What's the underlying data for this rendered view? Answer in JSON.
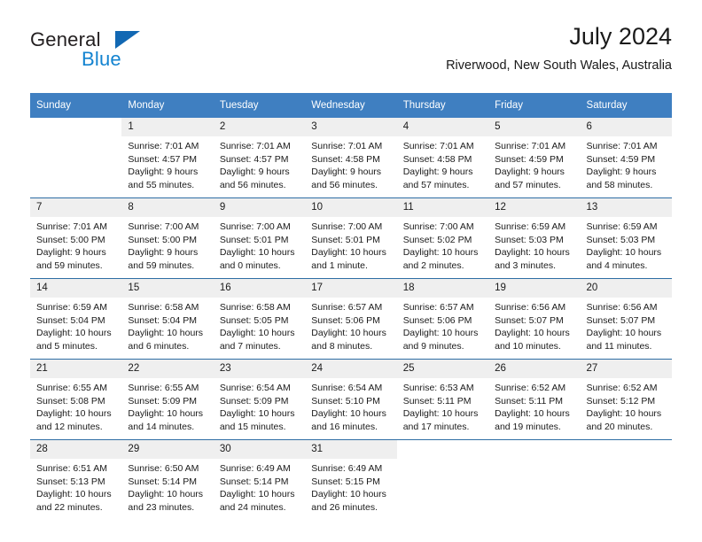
{
  "brand": {
    "name_top": "General",
    "name_bottom": "Blue",
    "accent_color": "#1383d0",
    "triangle_color": "#1268b3"
  },
  "header": {
    "title": "July 2024",
    "location": "Riverwood, New South Wales, Australia"
  },
  "calendar": {
    "header_background": "#3f7fc1",
    "header_text_color": "#ffffff",
    "daynum_background": "#efefef",
    "row_divider_color": "#2e6da4",
    "weekday_headers": [
      "Sunday",
      "Monday",
      "Tuesday",
      "Wednesday",
      "Thursday",
      "Friday",
      "Saturday"
    ],
    "weeks": [
      [
        {
          "day": "",
          "sunrise": "",
          "sunset": "",
          "daylight_1": "",
          "daylight_2": ""
        },
        {
          "day": "1",
          "sunrise": "Sunrise: 7:01 AM",
          "sunset": "Sunset: 4:57 PM",
          "daylight_1": "Daylight: 9 hours",
          "daylight_2": "and 55 minutes."
        },
        {
          "day": "2",
          "sunrise": "Sunrise: 7:01 AM",
          "sunset": "Sunset: 4:57 PM",
          "daylight_1": "Daylight: 9 hours",
          "daylight_2": "and 56 minutes."
        },
        {
          "day": "3",
          "sunrise": "Sunrise: 7:01 AM",
          "sunset": "Sunset: 4:58 PM",
          "daylight_1": "Daylight: 9 hours",
          "daylight_2": "and 56 minutes."
        },
        {
          "day": "4",
          "sunrise": "Sunrise: 7:01 AM",
          "sunset": "Sunset: 4:58 PM",
          "daylight_1": "Daylight: 9 hours",
          "daylight_2": "and 57 minutes."
        },
        {
          "day": "5",
          "sunrise": "Sunrise: 7:01 AM",
          "sunset": "Sunset: 4:59 PM",
          "daylight_1": "Daylight: 9 hours",
          "daylight_2": "and 57 minutes."
        },
        {
          "day": "6",
          "sunrise": "Sunrise: 7:01 AM",
          "sunset": "Sunset: 4:59 PM",
          "daylight_1": "Daylight: 9 hours",
          "daylight_2": "and 58 minutes."
        }
      ],
      [
        {
          "day": "7",
          "sunrise": "Sunrise: 7:01 AM",
          "sunset": "Sunset: 5:00 PM",
          "daylight_1": "Daylight: 9 hours",
          "daylight_2": "and 59 minutes."
        },
        {
          "day": "8",
          "sunrise": "Sunrise: 7:00 AM",
          "sunset": "Sunset: 5:00 PM",
          "daylight_1": "Daylight: 9 hours",
          "daylight_2": "and 59 minutes."
        },
        {
          "day": "9",
          "sunrise": "Sunrise: 7:00 AM",
          "sunset": "Sunset: 5:01 PM",
          "daylight_1": "Daylight: 10 hours",
          "daylight_2": "and 0 minutes."
        },
        {
          "day": "10",
          "sunrise": "Sunrise: 7:00 AM",
          "sunset": "Sunset: 5:01 PM",
          "daylight_1": "Daylight: 10 hours",
          "daylight_2": "and 1 minute."
        },
        {
          "day": "11",
          "sunrise": "Sunrise: 7:00 AM",
          "sunset": "Sunset: 5:02 PM",
          "daylight_1": "Daylight: 10 hours",
          "daylight_2": "and 2 minutes."
        },
        {
          "day": "12",
          "sunrise": "Sunrise: 6:59 AM",
          "sunset": "Sunset: 5:03 PM",
          "daylight_1": "Daylight: 10 hours",
          "daylight_2": "and 3 minutes."
        },
        {
          "day": "13",
          "sunrise": "Sunrise: 6:59 AM",
          "sunset": "Sunset: 5:03 PM",
          "daylight_1": "Daylight: 10 hours",
          "daylight_2": "and 4 minutes."
        }
      ],
      [
        {
          "day": "14",
          "sunrise": "Sunrise: 6:59 AM",
          "sunset": "Sunset: 5:04 PM",
          "daylight_1": "Daylight: 10 hours",
          "daylight_2": "and 5 minutes."
        },
        {
          "day": "15",
          "sunrise": "Sunrise: 6:58 AM",
          "sunset": "Sunset: 5:04 PM",
          "daylight_1": "Daylight: 10 hours",
          "daylight_2": "and 6 minutes."
        },
        {
          "day": "16",
          "sunrise": "Sunrise: 6:58 AM",
          "sunset": "Sunset: 5:05 PM",
          "daylight_1": "Daylight: 10 hours",
          "daylight_2": "and 7 minutes."
        },
        {
          "day": "17",
          "sunrise": "Sunrise: 6:57 AM",
          "sunset": "Sunset: 5:06 PM",
          "daylight_1": "Daylight: 10 hours",
          "daylight_2": "and 8 minutes."
        },
        {
          "day": "18",
          "sunrise": "Sunrise: 6:57 AM",
          "sunset": "Sunset: 5:06 PM",
          "daylight_1": "Daylight: 10 hours",
          "daylight_2": "and 9 minutes."
        },
        {
          "day": "19",
          "sunrise": "Sunrise: 6:56 AM",
          "sunset": "Sunset: 5:07 PM",
          "daylight_1": "Daylight: 10 hours",
          "daylight_2": "and 10 minutes."
        },
        {
          "day": "20",
          "sunrise": "Sunrise: 6:56 AM",
          "sunset": "Sunset: 5:07 PM",
          "daylight_1": "Daylight: 10 hours",
          "daylight_2": "and 11 minutes."
        }
      ],
      [
        {
          "day": "21",
          "sunrise": "Sunrise: 6:55 AM",
          "sunset": "Sunset: 5:08 PM",
          "daylight_1": "Daylight: 10 hours",
          "daylight_2": "and 12 minutes."
        },
        {
          "day": "22",
          "sunrise": "Sunrise: 6:55 AM",
          "sunset": "Sunset: 5:09 PM",
          "daylight_1": "Daylight: 10 hours",
          "daylight_2": "and 14 minutes."
        },
        {
          "day": "23",
          "sunrise": "Sunrise: 6:54 AM",
          "sunset": "Sunset: 5:09 PM",
          "daylight_1": "Daylight: 10 hours",
          "daylight_2": "and 15 minutes."
        },
        {
          "day": "24",
          "sunrise": "Sunrise: 6:54 AM",
          "sunset": "Sunset: 5:10 PM",
          "daylight_1": "Daylight: 10 hours",
          "daylight_2": "and 16 minutes."
        },
        {
          "day": "25",
          "sunrise": "Sunrise: 6:53 AM",
          "sunset": "Sunset: 5:11 PM",
          "daylight_1": "Daylight: 10 hours",
          "daylight_2": "and 17 minutes."
        },
        {
          "day": "26",
          "sunrise": "Sunrise: 6:52 AM",
          "sunset": "Sunset: 5:11 PM",
          "daylight_1": "Daylight: 10 hours",
          "daylight_2": "and 19 minutes."
        },
        {
          "day": "27",
          "sunrise": "Sunrise: 6:52 AM",
          "sunset": "Sunset: 5:12 PM",
          "daylight_1": "Daylight: 10 hours",
          "daylight_2": "and 20 minutes."
        }
      ],
      [
        {
          "day": "28",
          "sunrise": "Sunrise: 6:51 AM",
          "sunset": "Sunset: 5:13 PM",
          "daylight_1": "Daylight: 10 hours",
          "daylight_2": "and 22 minutes."
        },
        {
          "day": "29",
          "sunrise": "Sunrise: 6:50 AM",
          "sunset": "Sunset: 5:14 PM",
          "daylight_1": "Daylight: 10 hours",
          "daylight_2": "and 23 minutes."
        },
        {
          "day": "30",
          "sunrise": "Sunrise: 6:49 AM",
          "sunset": "Sunset: 5:14 PM",
          "daylight_1": "Daylight: 10 hours",
          "daylight_2": "and 24 minutes."
        },
        {
          "day": "31",
          "sunrise": "Sunrise: 6:49 AM",
          "sunset": "Sunset: 5:15 PM",
          "daylight_1": "Daylight: 10 hours",
          "daylight_2": "and 26 minutes."
        },
        {
          "day": "",
          "sunrise": "",
          "sunset": "",
          "daylight_1": "",
          "daylight_2": ""
        },
        {
          "day": "",
          "sunrise": "",
          "sunset": "",
          "daylight_1": "",
          "daylight_2": ""
        },
        {
          "day": "",
          "sunrise": "",
          "sunset": "",
          "daylight_1": "",
          "daylight_2": ""
        }
      ]
    ]
  }
}
